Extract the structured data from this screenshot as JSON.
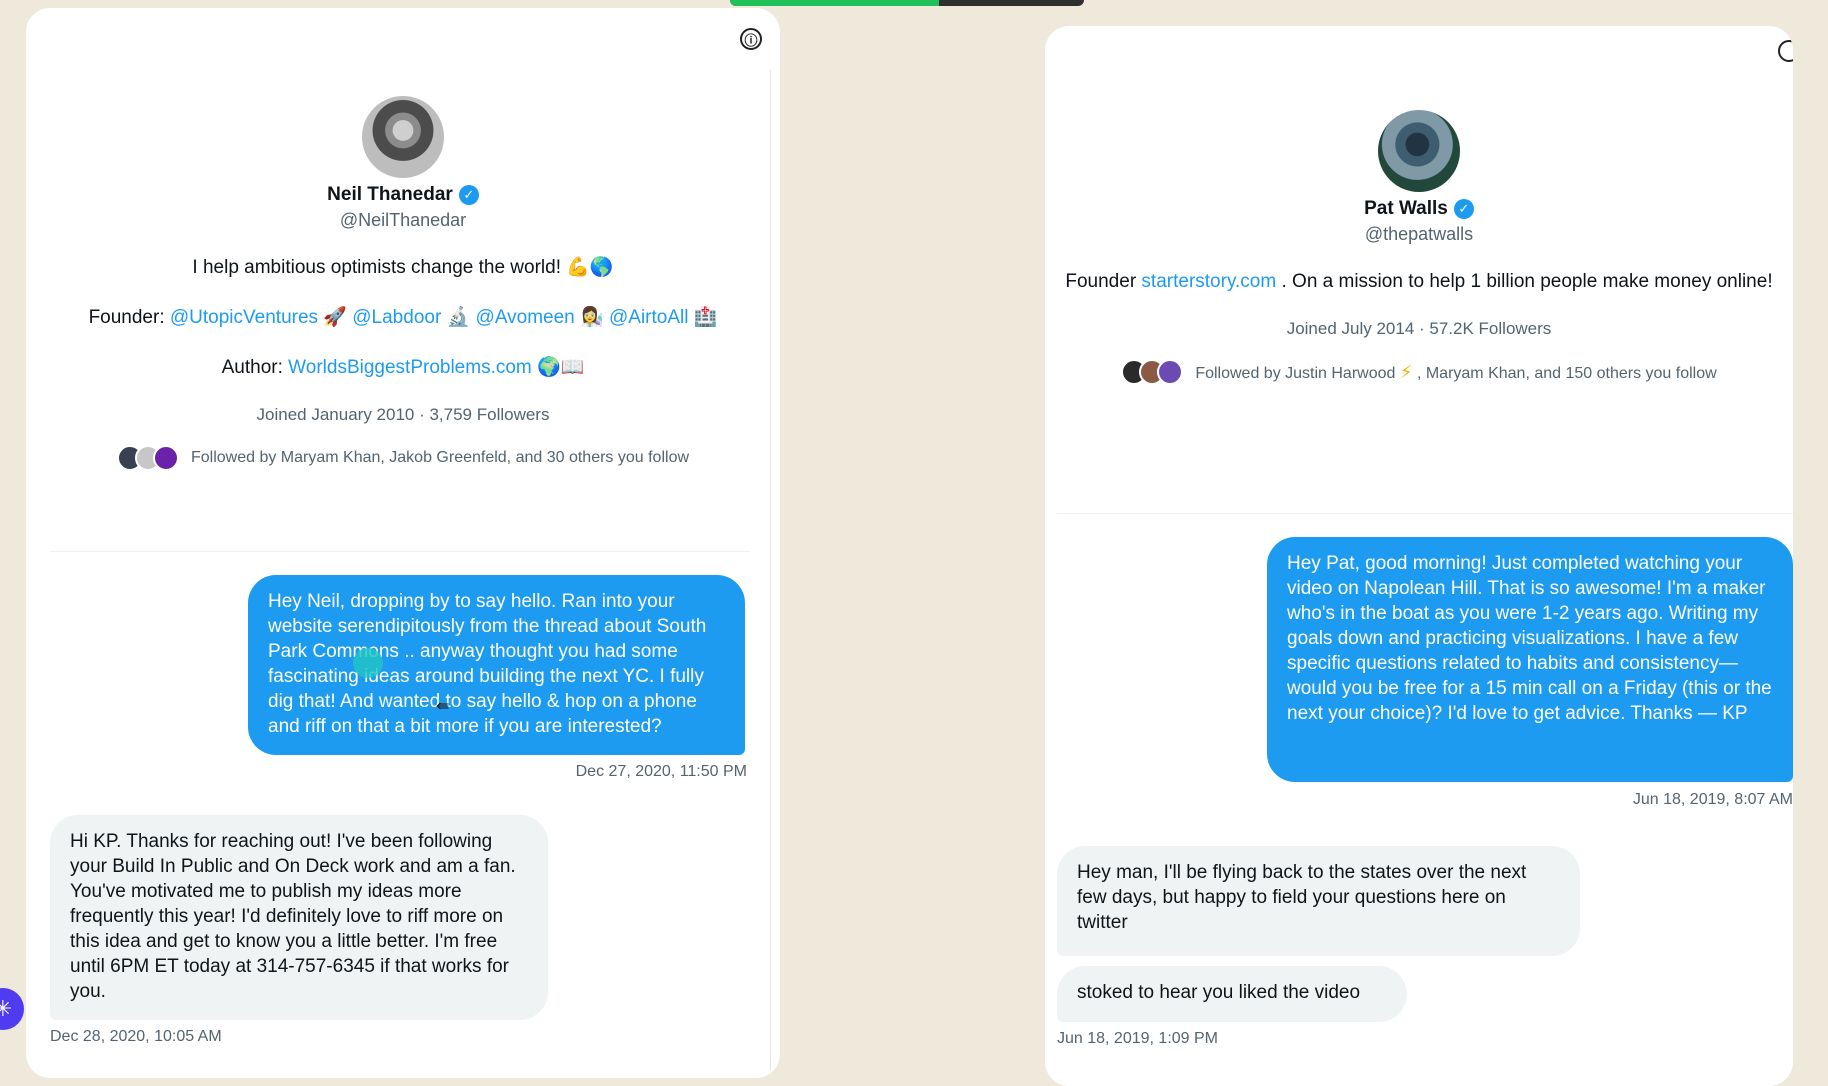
{
  "left_profile": {
    "name": "Neil Thanedar",
    "handle": "@NeilThanedar",
    "bio_line_1": "I help ambitious optimists change the world! 💪🌎",
    "bio_line_2_prefix": "Founder: ",
    "bio_line_2_links": [
      "@UtopicVentures",
      "@Labdoor",
      "@Avomeen",
      "@AirtoAll"
    ],
    "bio_line_2_emojis": [
      "🚀",
      "🔬",
      "👩‍🔬",
      "🏥"
    ],
    "bio_line_3_prefix": "Author: ",
    "bio_line_3_link": "WorldsBiggestProblems.com",
    "bio_line_3_suffix": " 🌍📖",
    "joined_text": "Joined January 2010 · 3,759 Followers",
    "followed_text": "Followed by Maryam Khan, Jakob Greenfeld, and 30 others you follow"
  },
  "left_messages": {
    "sent_text": "Hey Neil, dropping by to say hello. Ran into your website serendipitously from the thread about South Park Commons .. anyway thought you had some fascinating ideas around building the next YC. I fully dig that! And wanted to say hello & hop on a phone and riff on that a bit more if you are interested?",
    "sent_time": "Dec 27, 2020, 11:50 PM",
    "reply_text": "Hi KP. Thanks for reaching out! I've been following your Build In Public and On Deck work and am a fan. You've motivated me to publish my ideas more frequently this year! I'd definitely love to riff more on this idea and get to know you a little better. I'm free until 6PM ET today at 314-757-6345 if that works for you.",
    "reply_time": "Dec 28, 2020, 10:05 AM"
  },
  "right_profile": {
    "name": "Pat Walls",
    "handle": "@thepatwalls",
    "bio_prefix": "Founder ",
    "bio_link": "starterstory.com",
    "bio_suffix": ". On a mission to help 1 billion people make money online!",
    "joined_text": "Joined July 2014 · 57.2K Followers",
    "followed_prefix": "Followed by Justin Harwood ",
    "followed_emoji": "⚡",
    "followed_suffix": ", Maryam Khan, and 150 others you follow"
  },
  "right_messages": {
    "sent_text": "Hey Pat, good morning! Just completed watching your video on Napolean Hill. That is so awesome! I'm a maker who's in the boat as you were 1-2 years ago. Writing my goals down and practicing visualizations. I have a few specific questions related to habits and consistency— would you be free for a 15 min call on a Friday (this or the next your choice)? I'd love to get advice. Thanks — KP",
    "sent_time": "Jun 18, 2019, 8:07 AM",
    "reply_1": "Hey man, I'll be flying back to the states over the next few days, but happy to field your questions here on twitter",
    "reply_2": "stoked to hear you liked the video",
    "reply_time": "Jun 18, 2019, 1:09 PM"
  },
  "progress": {
    "value": 0.59
  },
  "icons": {
    "info": "ⓘ",
    "verified": "✓",
    "assistant": "✳",
    "cursor": "⇚"
  },
  "colors": {
    "accent": "#1d9bf0",
    "background": "#efe9dc",
    "incoming_bubble": "#eff3f4",
    "progress": "#20c05a",
    "assistant": "#4f3cf0"
  }
}
